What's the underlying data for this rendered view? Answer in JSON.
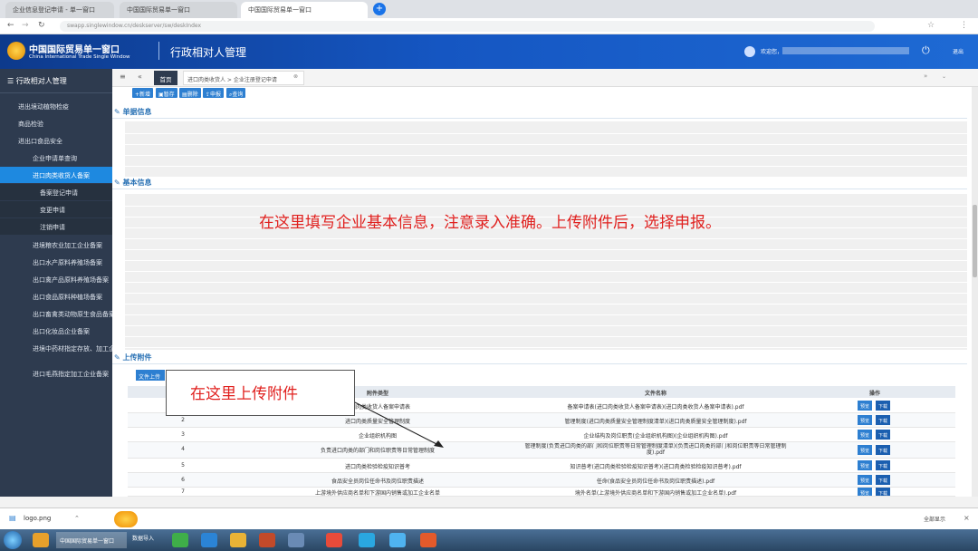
{
  "browser": {
    "tabs": [
      "企业信息登记申请 - 单一窗口",
      "中国国际贸易单一窗口",
      "中国国际贸易单一窗口"
    ],
    "url": "swapp.singlewindow.cn/deskserver/sw/deskIndex"
  },
  "header": {
    "logo_cn": "中国国际贸易单一窗口",
    "logo_en": "China International Trade Single Window",
    "module": "行政相对人管理",
    "user": "欢迎您，",
    "logout": "退出"
  },
  "sidebar": {
    "title": "行政相对人管理",
    "items": [
      {
        "label": "进出境动植物检疫",
        "level": 1
      },
      {
        "label": "商品检验",
        "level": 1
      },
      {
        "label": "进出口食品安全",
        "level": 1
      },
      {
        "label": "企业申请单查询",
        "level": 2
      },
      {
        "label": "进口肉类收货人备案",
        "level": 2,
        "active": true
      },
      {
        "label": "备案登记申请",
        "level": 3
      },
      {
        "label": "变更申请",
        "level": 3
      },
      {
        "label": "注销申请",
        "level": 3
      },
      {
        "label": "进境粮农业加工企业备案",
        "level": 2
      },
      {
        "label": "出口水产原料养殖场备案",
        "level": 2
      },
      {
        "label": "出口禽产品原料养殖场备案",
        "level": 2
      },
      {
        "label": "出口食品原料种植场备案",
        "level": 2
      },
      {
        "label": "出口畜禽类动物原生食品备案",
        "level": 2
      },
      {
        "label": "出口化妆品企业备案",
        "level": 2
      },
      {
        "label": "进境中药材指定存放、加工企业",
        "level": 2
      },
      {
        "label": "进口毛燕指定加工企业备案",
        "level": 2
      }
    ]
  },
  "tabs": {
    "home": "首页",
    "current": "进口肉类收货人 > 企业注册登记申请"
  },
  "toolbar": {
    "new": "新增",
    "save": "暂存",
    "delete": "删除",
    "submit": "申报",
    "query": "查询"
  },
  "sections": {
    "doc_info": "单据信息",
    "basic_info": "基本信息",
    "attachments": "上传附件",
    "upload_btn": "文件上传"
  },
  "annotations": {
    "main": "在这里填写企业基本信息，注意录入准确。上传附件后，选择申报。",
    "upload": "在这里上传附件"
  },
  "attach_table": {
    "headers": [
      "序号",
      "附件类型",
      "文件名称",
      "操作"
    ],
    "preview_label": "预览",
    "download_label": "下载",
    "rows": [
      {
        "no": "1",
        "type": "进口肉类收货人备案申请表",
        "file": "备案申请表(进口肉类收货人备案申请表)(进口肉类收货人备案申请表).pdf"
      },
      {
        "no": "2",
        "type": "进口肉类质量安全管理制度",
        "file": "管理制度(进口肉类质量安全管理制度清单)(进口肉类质量安全管理制度).pdf"
      },
      {
        "no": "3",
        "type": "企业组织机构图",
        "file": "企业结构及岗位职责(企业组织机构图)(企业组织机构图).pdf"
      },
      {
        "no": "4",
        "type": "负责进口肉类的部门和岗位职责等日常管理制度",
        "file": "管理制度(负责进口肉类的部门和岗位职责等日常管理制度清单)(负责进口肉类的部门和岗位职责等日常管理制度).pdf"
      },
      {
        "no": "5",
        "type": "进口肉类检验检疫知识普考",
        "file": "知识普考(进口肉类检验检疫知识普考)(进口肉类检验检疫知识普考).pdf"
      },
      {
        "no": "6",
        "type": "食品安全员岗位任命书及岗位职责描述",
        "file": "任命(食品安全员岗位任命书及岗位职责描述).pdf"
      },
      {
        "no": "7",
        "type": "上游境外供应商名单和下游国内销售或加工企业名单",
        "file": "境外名单(上游境外供应商名单和下游国内销售或加工企业名单).pdf"
      }
    ]
  },
  "download_bar": {
    "file": "logo.png",
    "show_all": "全部显示"
  },
  "taskbar": {
    "task": "数据导入"
  }
}
